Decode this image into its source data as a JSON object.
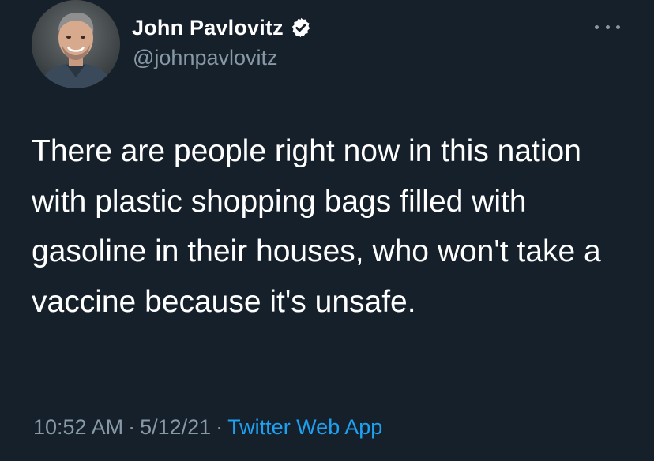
{
  "author": {
    "display_name": "John Pavlovitz",
    "handle": "@johnpavlovitz",
    "verified": true
  },
  "tweet": {
    "text": "There are people right now in this nation with plastic shopping bags filled with gasoline in their houses, who won't take a vaccine because it's unsafe.",
    "time": "10:52 AM",
    "date": "5/12/21",
    "separator": "·",
    "source": "Twitter Web App"
  },
  "colors": {
    "background": "#15202b",
    "primary_text": "#ffffff",
    "secondary_text": "#8899a6",
    "accent": "#1da1f2"
  },
  "icons": {
    "verified": "verified-badge-icon",
    "more": "more-options-icon"
  }
}
